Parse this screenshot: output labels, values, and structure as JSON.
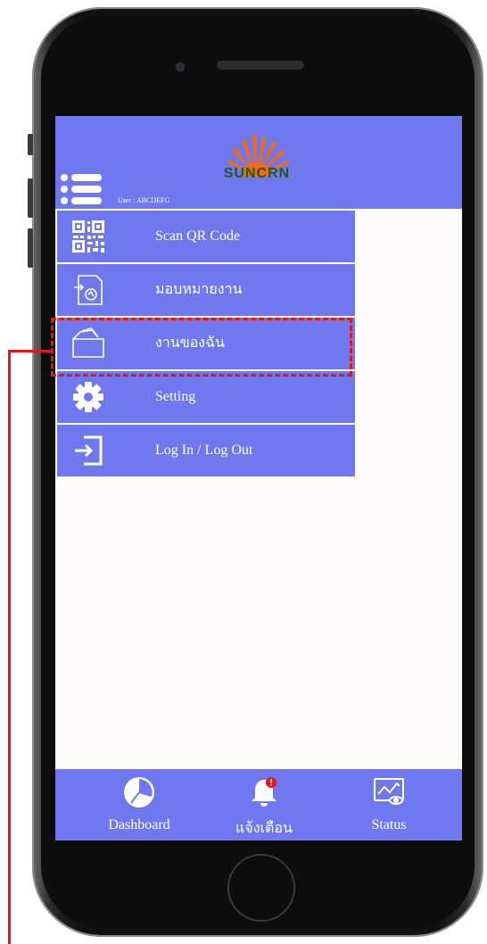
{
  "app": {
    "logo_text": "SUNCRN",
    "user_label": "User",
    "user_name": "ABCDEFG"
  },
  "menu": {
    "items": [
      {
        "label": "Scan QR Code",
        "icon": "qr-code-icon"
      },
      {
        "label": "มอบหมายงาน",
        "icon": "assign-task-icon"
      },
      {
        "label": "งานของฉัน",
        "icon": "folder-icon"
      },
      {
        "label": "Setting",
        "icon": "gear-icon"
      },
      {
        "label": "Log In / Log Out",
        "icon": "login-icon"
      }
    ]
  },
  "tabs": [
    {
      "label": "Dashboard",
      "icon": "pie-chart-icon"
    },
    {
      "label": "แจ้งเตือน",
      "icon": "bell-icon"
    },
    {
      "label": "Status",
      "icon": "status-chart-icon"
    }
  ],
  "colors": {
    "accent": "#6f78ee",
    "annotation": "#e3161e",
    "logo_orange": "#ef6a1a",
    "logo_green": "#1f5a1f"
  }
}
